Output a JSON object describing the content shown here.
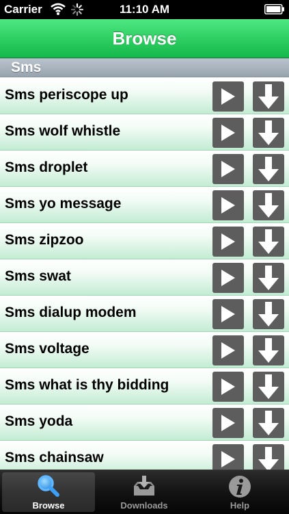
{
  "status_bar": {
    "carrier": "Carrier",
    "time": "11:10 AM"
  },
  "nav": {
    "title": "Browse"
  },
  "section": {
    "title": "Sms"
  },
  "items": [
    {
      "label": "Sms periscope up"
    },
    {
      "label": "Sms wolf whistle"
    },
    {
      "label": "Sms droplet"
    },
    {
      "label": "Sms yo message"
    },
    {
      "label": "Sms zipzoo"
    },
    {
      "label": "Sms swat"
    },
    {
      "label": "Sms dialup modem"
    },
    {
      "label": "Sms voltage"
    },
    {
      "label": "Sms what is thy bidding"
    },
    {
      "label": "Sms yoda"
    },
    {
      "label": "Sms chainsaw"
    }
  ],
  "tabs": [
    {
      "label": "Browse",
      "icon": "search-icon",
      "selected": true
    },
    {
      "label": "Downloads",
      "icon": "downloads-icon",
      "selected": false
    },
    {
      "label": "Help",
      "icon": "info-icon",
      "selected": false
    }
  ],
  "colors": {
    "nav_green": "#2fcf63",
    "button_gray": "#5d5d5d",
    "row_green": "#c3ecd3"
  }
}
